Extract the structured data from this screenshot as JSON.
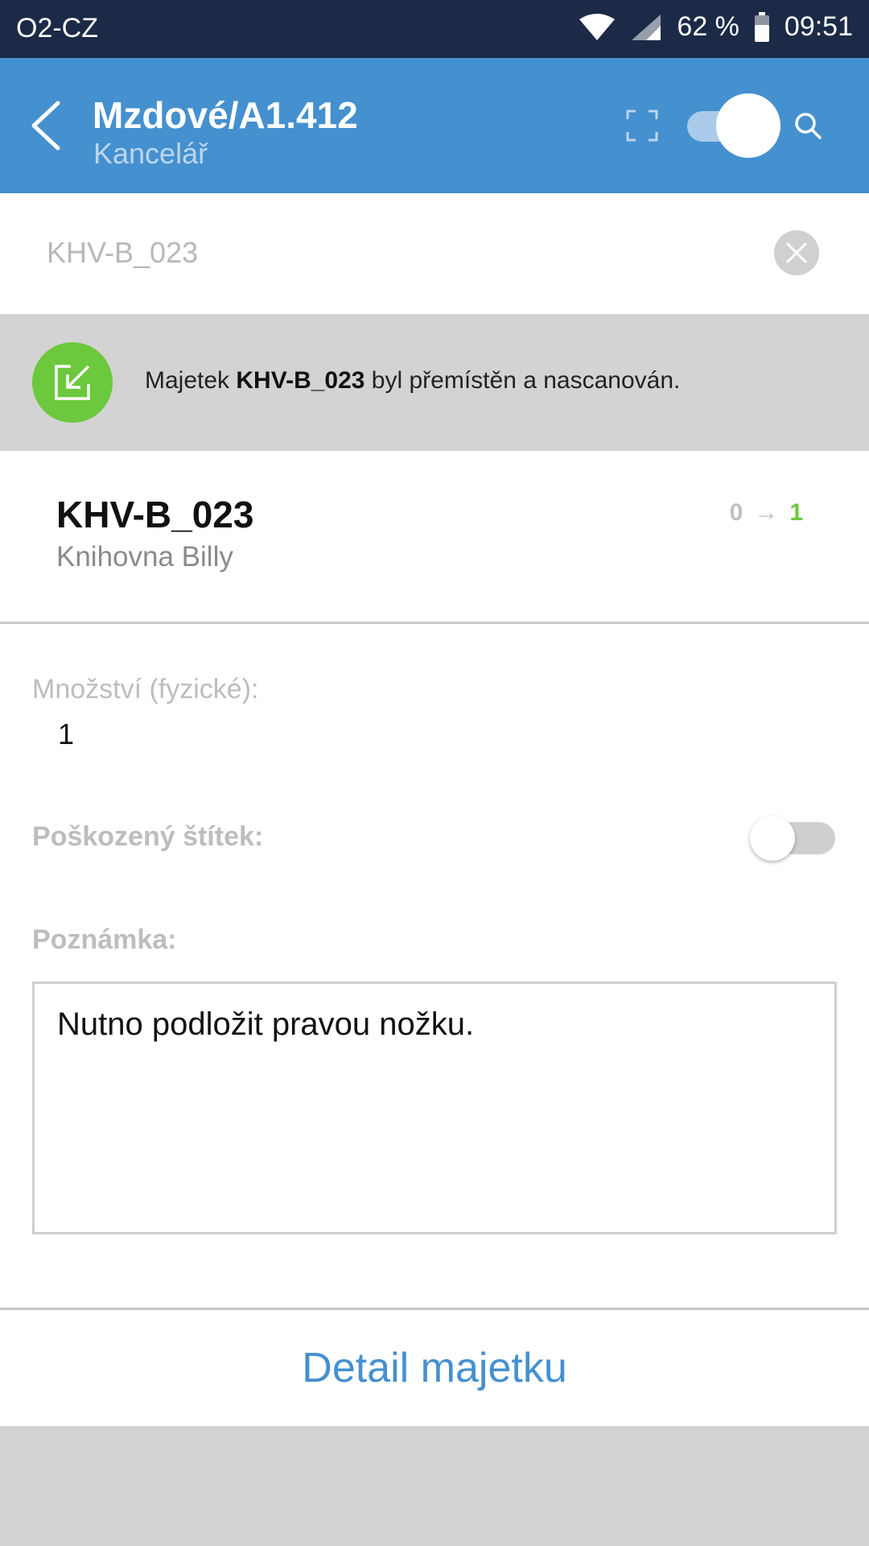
{
  "status_bar": {
    "carrier": "O2-CZ",
    "battery": "62 %",
    "time": "09:51",
    "icons": [
      "wifi-icon",
      "signal-icon",
      "battery-icon"
    ]
  },
  "app_bar": {
    "title": "Mzdové/A1.412",
    "subtitle": "Kancelář",
    "icons": [
      "back-arrow-icon",
      "scan-frame-icon",
      "search-icon"
    ],
    "mode_toggle_on": true,
    "color": "#4590cf"
  },
  "search": {
    "value": "KHV-B_023"
  },
  "notice": {
    "prefix": "Majetek ",
    "asset_code": "KHV-B_023",
    "suffix": " byl přemístěn a nascanován.",
    "icon": "move-into-icon",
    "icon_color": "#6cc83c"
  },
  "asset": {
    "code": "KHV-B_023",
    "name": "Knihovna Billy",
    "qty_from": "0",
    "qty_arrow": "→",
    "qty_to": "1"
  },
  "form": {
    "qty_label": "Množství (fyzické):",
    "qty_value": "1",
    "damaged_label": "Poškozený štítek:",
    "damaged_on": false,
    "note_label": "Poznámka:",
    "note_value": "Nutno podložit pravou nožku."
  },
  "detail_button": "Detail majetku"
}
